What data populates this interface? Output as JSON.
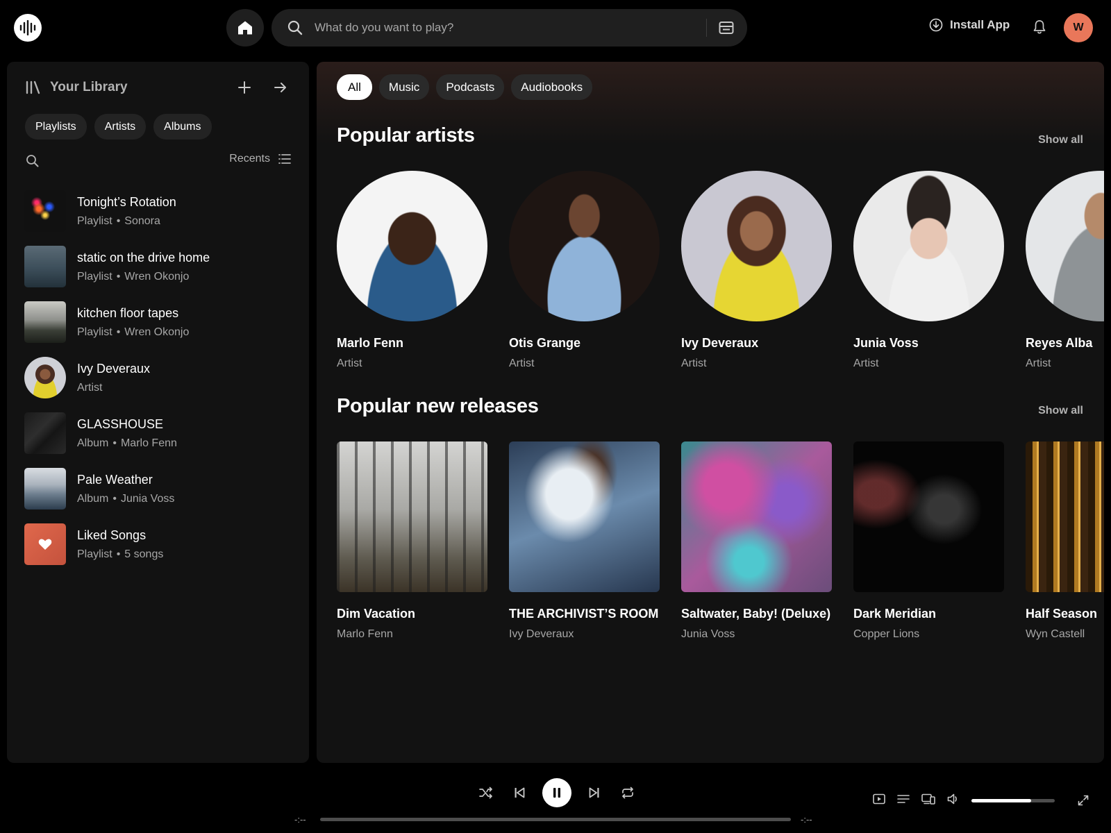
{
  "header": {
    "search_placeholder": "What do you want to play?",
    "install_label": "Install App",
    "avatar_letter": "W",
    "avatar_color": "#e9775a"
  },
  "library": {
    "title": "Your Library",
    "chips": [
      "Playlists",
      "Artists",
      "Albums"
    ],
    "sort_label": "Recents",
    "items": [
      {
        "title": "Tonight’s Rotation",
        "type": "Playlist",
        "owner": "Sonora"
      },
      {
        "title": "static on the drive home",
        "type": "Playlist",
        "owner": "Wren Okonjo"
      },
      {
        "title": "kitchen floor tapes",
        "type": "Playlist",
        "owner": "Wren Okonjo"
      },
      {
        "title": "Ivy Deveraux",
        "type": "Artist",
        "owner": ""
      },
      {
        "title": "GLASSHOUSE",
        "type": "Album",
        "owner": "Marlo Fenn"
      },
      {
        "title": "Pale Weather",
        "type": "Album",
        "owner": "Junia Voss"
      },
      {
        "title": "Liked Songs",
        "type": "Playlist",
        "owner": "5 songs"
      }
    ]
  },
  "main": {
    "filters": [
      "All",
      "Music",
      "Podcasts",
      "Audiobooks"
    ],
    "popular_artists": {
      "title": "Popular artists",
      "show_all": "Show all",
      "items": [
        {
          "name": "Marlo Fenn",
          "sub": "Artist"
        },
        {
          "name": "Otis Grange",
          "sub": "Artist"
        },
        {
          "name": "Ivy Deveraux",
          "sub": "Artist"
        },
        {
          "name": "Junia Voss",
          "sub": "Artist"
        },
        {
          "name": "Reyes Alba",
          "sub": "Artist"
        }
      ]
    },
    "new_releases": {
      "title": "Popular new releases",
      "show_all": "Show all",
      "items": [
        {
          "name": "Dim Vacation",
          "sub": "Marlo Fenn"
        },
        {
          "name": "THE ARCHIVIST’S ROOM",
          "sub": "Ivy Deveraux"
        },
        {
          "name": "Saltwater, Baby! (Deluxe)",
          "sub": "Junia Voss"
        },
        {
          "name": "Dark Meridian",
          "sub": "Copper Lions"
        },
        {
          "name": "Half Season",
          "sub": "Wyn Castell"
        }
      ]
    }
  },
  "player": {
    "time_elapsed": "-:--",
    "time_total": "-:--",
    "progress": 0,
    "volume": 0.72
  }
}
